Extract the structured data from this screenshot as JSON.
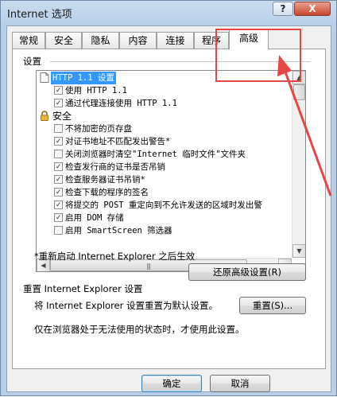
{
  "window": {
    "title": "Internet 选项",
    "help_glyph": "?",
    "close_glyph": "X"
  },
  "tabs": [
    "常规",
    "安全",
    "隐私",
    "内容",
    "连接",
    "程序",
    "高级"
  ],
  "active_tab": "高级",
  "settings": {
    "label": "设置",
    "rows": [
      {
        "kind": "category",
        "icon": "page-icon",
        "text": "HTTP 1.1 设置",
        "selected": true
      },
      {
        "kind": "option",
        "checked": true,
        "text": "使用 HTTP 1.1"
      },
      {
        "kind": "option",
        "checked": true,
        "text": "通过代理连接使用 HTTP 1.1"
      },
      {
        "kind": "category",
        "icon": "lock-icon",
        "text": "安全",
        "selected": false
      },
      {
        "kind": "option",
        "checked": false,
        "text": "不将加密的页存盘"
      },
      {
        "kind": "option",
        "checked": true,
        "text": "对证书地址不匹配发出警告*"
      },
      {
        "kind": "option",
        "checked": false,
        "text": "关闭浏览器时清空\"Internet 临时文件\"文件夹"
      },
      {
        "kind": "option",
        "checked": true,
        "text": "检查发行商的证书是否吊销"
      },
      {
        "kind": "option",
        "checked": true,
        "text": "检查服务器证书吊销*"
      },
      {
        "kind": "option",
        "checked": true,
        "text": "检查下载的程序的签名"
      },
      {
        "kind": "option",
        "checked": true,
        "text": "将提交的 POST 重定向到不允许发送的区域时发出警"
      },
      {
        "kind": "option",
        "checked": true,
        "text": "启用 DOM 存储"
      },
      {
        "kind": "option",
        "checked": false,
        "text": "启用 SmartScreen 筛选器"
      }
    ],
    "restart_note": "*重新启动 Internet Explorer 之后生效",
    "restore_button": "还原高级设置(R)"
  },
  "reset": {
    "heading": "重置 Internet Explorer 设置",
    "description": "将 Internet Explorer 设置重置为默认设置。",
    "button": "重置(S)...",
    "note": "仅在浏览器处于无法使用的状态时，才使用此设置。"
  },
  "footer": {
    "ok": "确定",
    "cancel": "取消"
  },
  "colors": {
    "selection": "#3399ff",
    "annotation": "#e84646",
    "title_gradient": "#c9dcef"
  }
}
